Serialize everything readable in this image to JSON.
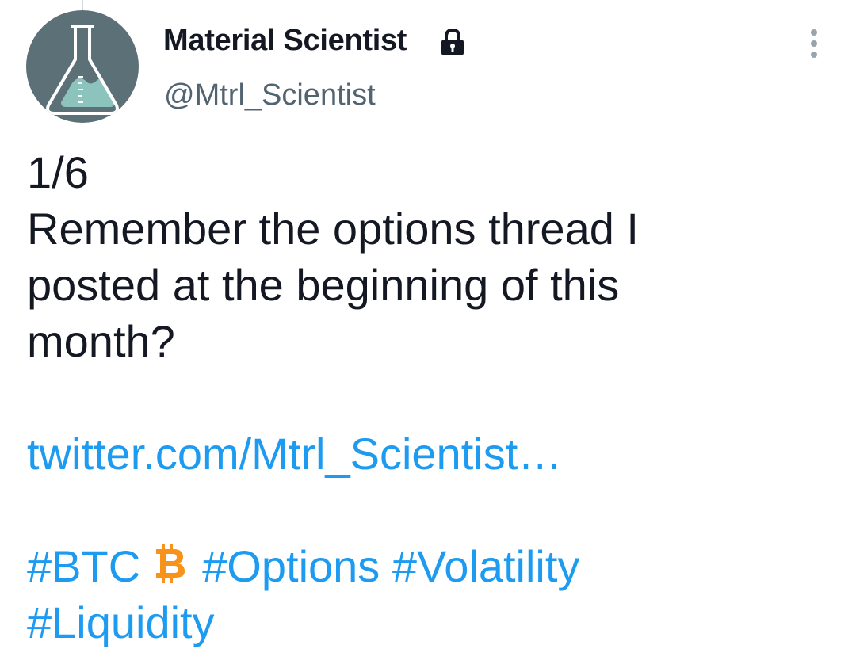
{
  "tweet": {
    "author": {
      "display_name": "Material Scientist",
      "handle": "@Mtrl_Scientist",
      "protected_icon": "lock-icon",
      "avatar_icon": "flask-icon"
    },
    "more_icon": "more-vertical-icon",
    "body": {
      "counter": "1/6",
      "lines": [
        "Remember the options thread I",
        "posted at the beginning of this",
        "month?"
      ],
      "link": "twitter.com/Mtrl_Scientist…",
      "hashtags_line1": {
        "btc": "#BTC",
        "emoji": "bitcoin-icon",
        "rest": "#Options #Volatility"
      },
      "hashtags_line2": "#Liquidity"
    }
  },
  "colors": {
    "link": "#1d9bf0",
    "text": "#141823",
    "secondary_text": "#536471",
    "avatar_bg": "#5c7077",
    "avatar_liquid": "#8cc4bd",
    "bitcoin": "#f7931a"
  }
}
